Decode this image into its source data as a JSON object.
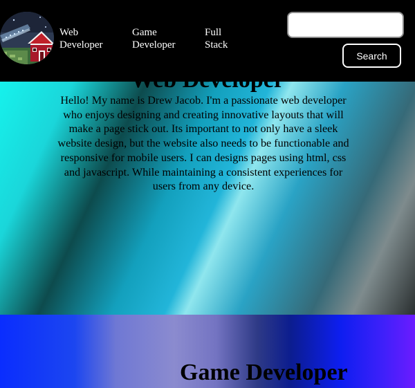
{
  "nav": {
    "links": [
      {
        "line1": "Web",
        "line2": "Developer"
      },
      {
        "line1": "Game",
        "line2": "Developer"
      },
      {
        "line1": "Full",
        "line2": "Stack"
      }
    ]
  },
  "search": {
    "value": "",
    "button_label": "Search"
  },
  "logo": {
    "icon": "pixel-house-logo-icon"
  },
  "sections": {
    "web": {
      "title": "Web Developer",
      "text": "Hello! My name is Drew Jacob. I'm a passionate web developer who enjoys designing and creating innovative layouts that will make a page stick out. Its important to not only have a sleek website design, but the website also needs to be functionable and responsive for mobile users. I can designs pages using html, css and javascript. While maintaining a consistent experiences for users from any device."
    },
    "game": {
      "title": "Game Developer"
    }
  },
  "colors": {
    "header_bg": "#000000",
    "web_gradient_start": "#16f2ec",
    "game_gradient_start": "#0a2dfe",
    "game_gradient_end": "#6b1cff"
  }
}
